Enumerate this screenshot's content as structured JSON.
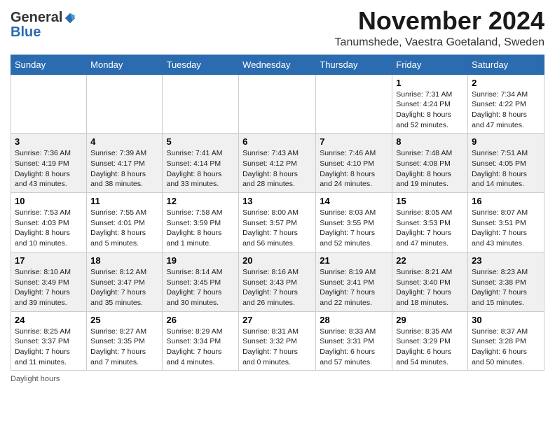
{
  "logo": {
    "general": "General",
    "blue": "Blue"
  },
  "title": "November 2024",
  "subtitle": "Tanumshede, Vaestra Goetaland, Sweden",
  "days_of_week": [
    "Sunday",
    "Monday",
    "Tuesday",
    "Wednesday",
    "Thursday",
    "Friday",
    "Saturday"
  ],
  "footer": "Daylight hours",
  "weeks": [
    [
      {
        "day": "",
        "sunrise": "",
        "sunset": "",
        "daylight": ""
      },
      {
        "day": "",
        "sunrise": "",
        "sunset": "",
        "daylight": ""
      },
      {
        "day": "",
        "sunrise": "",
        "sunset": "",
        "daylight": ""
      },
      {
        "day": "",
        "sunrise": "",
        "sunset": "",
        "daylight": ""
      },
      {
        "day": "",
        "sunrise": "",
        "sunset": "",
        "daylight": ""
      },
      {
        "day": "1",
        "sunrise": "Sunrise: 7:31 AM",
        "sunset": "Sunset: 4:24 PM",
        "daylight": "Daylight: 8 hours and 52 minutes."
      },
      {
        "day": "2",
        "sunrise": "Sunrise: 7:34 AM",
        "sunset": "Sunset: 4:22 PM",
        "daylight": "Daylight: 8 hours and 47 minutes."
      }
    ],
    [
      {
        "day": "3",
        "sunrise": "Sunrise: 7:36 AM",
        "sunset": "Sunset: 4:19 PM",
        "daylight": "Daylight: 8 hours and 43 minutes."
      },
      {
        "day": "4",
        "sunrise": "Sunrise: 7:39 AM",
        "sunset": "Sunset: 4:17 PM",
        "daylight": "Daylight: 8 hours and 38 minutes."
      },
      {
        "day": "5",
        "sunrise": "Sunrise: 7:41 AM",
        "sunset": "Sunset: 4:14 PM",
        "daylight": "Daylight: 8 hours and 33 minutes."
      },
      {
        "day": "6",
        "sunrise": "Sunrise: 7:43 AM",
        "sunset": "Sunset: 4:12 PM",
        "daylight": "Daylight: 8 hours and 28 minutes."
      },
      {
        "day": "7",
        "sunrise": "Sunrise: 7:46 AM",
        "sunset": "Sunset: 4:10 PM",
        "daylight": "Daylight: 8 hours and 24 minutes."
      },
      {
        "day": "8",
        "sunrise": "Sunrise: 7:48 AM",
        "sunset": "Sunset: 4:08 PM",
        "daylight": "Daylight: 8 hours and 19 minutes."
      },
      {
        "day": "9",
        "sunrise": "Sunrise: 7:51 AM",
        "sunset": "Sunset: 4:05 PM",
        "daylight": "Daylight: 8 hours and 14 minutes."
      }
    ],
    [
      {
        "day": "10",
        "sunrise": "Sunrise: 7:53 AM",
        "sunset": "Sunset: 4:03 PM",
        "daylight": "Daylight: 8 hours and 10 minutes."
      },
      {
        "day": "11",
        "sunrise": "Sunrise: 7:55 AM",
        "sunset": "Sunset: 4:01 PM",
        "daylight": "Daylight: 8 hours and 5 minutes."
      },
      {
        "day": "12",
        "sunrise": "Sunrise: 7:58 AM",
        "sunset": "Sunset: 3:59 PM",
        "daylight": "Daylight: 8 hours and 1 minute."
      },
      {
        "day": "13",
        "sunrise": "Sunrise: 8:00 AM",
        "sunset": "Sunset: 3:57 PM",
        "daylight": "Daylight: 7 hours and 56 minutes."
      },
      {
        "day": "14",
        "sunrise": "Sunrise: 8:03 AM",
        "sunset": "Sunset: 3:55 PM",
        "daylight": "Daylight: 7 hours and 52 minutes."
      },
      {
        "day": "15",
        "sunrise": "Sunrise: 8:05 AM",
        "sunset": "Sunset: 3:53 PM",
        "daylight": "Daylight: 7 hours and 47 minutes."
      },
      {
        "day": "16",
        "sunrise": "Sunrise: 8:07 AM",
        "sunset": "Sunset: 3:51 PM",
        "daylight": "Daylight: 7 hours and 43 minutes."
      }
    ],
    [
      {
        "day": "17",
        "sunrise": "Sunrise: 8:10 AM",
        "sunset": "Sunset: 3:49 PM",
        "daylight": "Daylight: 7 hours and 39 minutes."
      },
      {
        "day": "18",
        "sunrise": "Sunrise: 8:12 AM",
        "sunset": "Sunset: 3:47 PM",
        "daylight": "Daylight: 7 hours and 35 minutes."
      },
      {
        "day": "19",
        "sunrise": "Sunrise: 8:14 AM",
        "sunset": "Sunset: 3:45 PM",
        "daylight": "Daylight: 7 hours and 30 minutes."
      },
      {
        "day": "20",
        "sunrise": "Sunrise: 8:16 AM",
        "sunset": "Sunset: 3:43 PM",
        "daylight": "Daylight: 7 hours and 26 minutes."
      },
      {
        "day": "21",
        "sunrise": "Sunrise: 8:19 AM",
        "sunset": "Sunset: 3:41 PM",
        "daylight": "Daylight: 7 hours and 22 minutes."
      },
      {
        "day": "22",
        "sunrise": "Sunrise: 8:21 AM",
        "sunset": "Sunset: 3:40 PM",
        "daylight": "Daylight: 7 hours and 18 minutes."
      },
      {
        "day": "23",
        "sunrise": "Sunrise: 8:23 AM",
        "sunset": "Sunset: 3:38 PM",
        "daylight": "Daylight: 7 hours and 15 minutes."
      }
    ],
    [
      {
        "day": "24",
        "sunrise": "Sunrise: 8:25 AM",
        "sunset": "Sunset: 3:37 PM",
        "daylight": "Daylight: 7 hours and 11 minutes."
      },
      {
        "day": "25",
        "sunrise": "Sunrise: 8:27 AM",
        "sunset": "Sunset: 3:35 PM",
        "daylight": "Daylight: 7 hours and 7 minutes."
      },
      {
        "day": "26",
        "sunrise": "Sunrise: 8:29 AM",
        "sunset": "Sunset: 3:34 PM",
        "daylight": "Daylight: 7 hours and 4 minutes."
      },
      {
        "day": "27",
        "sunrise": "Sunrise: 8:31 AM",
        "sunset": "Sunset: 3:32 PM",
        "daylight": "Daylight: 7 hours and 0 minutes."
      },
      {
        "day": "28",
        "sunrise": "Sunrise: 8:33 AM",
        "sunset": "Sunset: 3:31 PM",
        "daylight": "Daylight: 6 hours and 57 minutes."
      },
      {
        "day": "29",
        "sunrise": "Sunrise: 8:35 AM",
        "sunset": "Sunset: 3:29 PM",
        "daylight": "Daylight: 6 hours and 54 minutes."
      },
      {
        "day": "30",
        "sunrise": "Sunrise: 8:37 AM",
        "sunset": "Sunset: 3:28 PM",
        "daylight": "Daylight: 6 hours and 50 minutes."
      }
    ]
  ]
}
